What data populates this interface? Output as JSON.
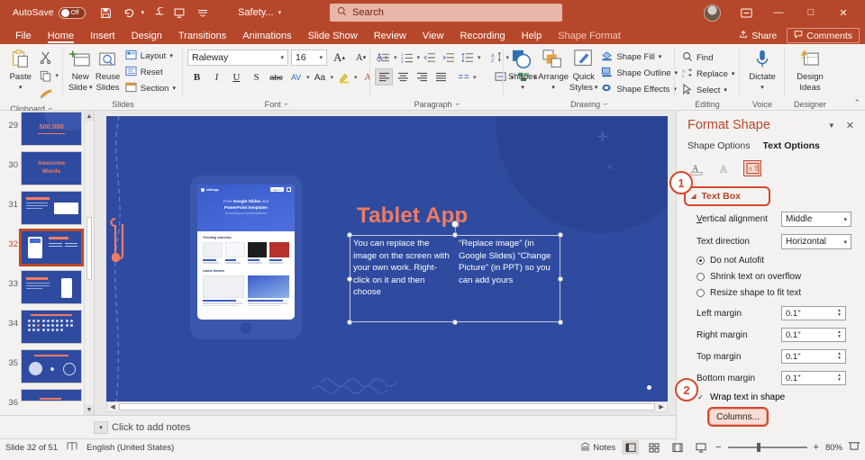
{
  "titlebar": {
    "autosave_label": "AutoSave",
    "autosave_state": "Off",
    "save_icon": "save-icon",
    "undo_icon": "undo-icon",
    "redo_icon": "redo-icon",
    "present_icon": "start-presentation-icon",
    "customize_icon": "customize-quick-access-icon",
    "filename": "Safety...",
    "search_placeholder": "Search",
    "search_icon": "search-icon",
    "account_icon": "user-avatar",
    "ribbon_display_icon": "ribbon-display-options-icon",
    "minimize": "—",
    "maximize": "□",
    "close": "✕"
  },
  "tabs": {
    "items": [
      {
        "label": "File",
        "active": false
      },
      {
        "label": "Home",
        "active": true
      },
      {
        "label": "Insert",
        "active": false
      },
      {
        "label": "Design",
        "active": false
      },
      {
        "label": "Transitions",
        "active": false
      },
      {
        "label": "Animations",
        "active": false
      },
      {
        "label": "Slide Show",
        "active": false
      },
      {
        "label": "Review",
        "active": false
      },
      {
        "label": "View",
        "active": false
      },
      {
        "label": "Recording",
        "active": false
      },
      {
        "label": "Help",
        "active": false
      },
      {
        "label": "Shape Format",
        "active": false
      }
    ],
    "share_label": "Share",
    "comments_label": "Comments"
  },
  "ribbon": {
    "clipboard": {
      "group_label": "Clipboard",
      "paste_label": "Paste",
      "cut_icon": "scissors-icon",
      "copy_icon": "copy-icon",
      "format_painter_icon": "format-painter-icon"
    },
    "slides": {
      "group_label": "Slides",
      "new_slide_label": "New\nSlide",
      "new_slide_line1": "New",
      "new_slide_line2": "Slide",
      "reuse_slides_line1": "Reuse",
      "reuse_slides_line2": "Slides",
      "layout_label": "Layout",
      "reset_label": "Reset",
      "section_label": "Section"
    },
    "font": {
      "group_label": "Font",
      "font_name": "Raleway",
      "font_size": "16",
      "grow_font": "A",
      "shrink_font": "A",
      "clear_formatting": "A",
      "bold": "B",
      "italic": "I",
      "underline": "U",
      "shadow": "S",
      "strikethrough": "abc",
      "char_spacing": "AV",
      "change_case": "Aa",
      "text_highlight": "highlight-icon",
      "font_color": "A"
    },
    "paragraph": {
      "group_label": "Paragraph",
      "bullets_icon": "bullets-icon",
      "numbering_icon": "numbering-icon",
      "decrease_indent_icon": "decrease-indent-icon",
      "increase_indent_icon": "increase-indent-icon",
      "line_spacing_icon": "line-spacing-icon",
      "align_left_icon": "align-left-icon",
      "align_center_icon": "align-center-icon",
      "align_right_icon": "align-right-icon",
      "justify_icon": "justify-icon",
      "columns_icon": "columns-icon",
      "text_direction_icon": "text-direction-icon",
      "align_text_icon": "align-text-icon",
      "smartart_icon": "convert-to-smartart-icon"
    },
    "drawing": {
      "group_label": "Drawing",
      "shapes_label": "Shapes",
      "arrange_label": "Arrange",
      "quick_styles_line1": "Quick",
      "quick_styles_line2": "Styles",
      "shape_fill_label": "Shape Fill",
      "shape_outline_label": "Shape Outline",
      "shape_effects_label": "Shape Effects"
    },
    "editing": {
      "group_label": "Editing",
      "find_label": "Find",
      "replace_label": "Replace",
      "select_label": "Select"
    },
    "voice": {
      "group_label": "Voice",
      "dictate_label": "Dictate"
    },
    "designer": {
      "group_label": "Designer",
      "design_ideas_line1": "Design",
      "design_ideas_line2": "Ideas"
    },
    "collapse_icon": "collapse-ribbon-icon"
  },
  "thumbnails": {
    "items": [
      {
        "number": "29",
        "kind": "big-number",
        "text": "500,000",
        "selected": false
      },
      {
        "number": "30",
        "kind": "two-line-title",
        "line1": "Awesome",
        "line2": "Words",
        "selected": false
      },
      {
        "number": "31",
        "kind": "text-left-image-right",
        "selected": false
      },
      {
        "number": "32",
        "kind": "image-left-text-right",
        "selected": true
      },
      {
        "number": "33",
        "kind": "text-left-phone-right",
        "selected": false
      },
      {
        "number": "34",
        "kind": "icon-grid",
        "selected": false
      },
      {
        "number": "35",
        "kind": "three-icons",
        "selected": false
      },
      {
        "number": "36",
        "kind": "partial",
        "selected": false
      }
    ]
  },
  "slide": {
    "title": "Tablet App",
    "text_column_1": "You can replace the image on the screen with your own work. Right-click on it and then choose",
    "text_column_2": "“Replace image” (in Google Slides) “Change Picture” (in PPT) so you can add yours",
    "tablet_hero_line1_a": "Free",
    "tablet_hero_line1_b": "Google Slides",
    "tablet_hero_line1_c": "and",
    "tablet_hero_line2": "PowerPoint templates",
    "tablet_hero_line3": "to boost your presentations",
    "tablet_section_1": "Trending searches",
    "tablet_section_2": "Latest themes",
    "tablet_logo": "slidesgo",
    "tablet_signin": "Sign in"
  },
  "notes": {
    "placeholder": "Click to add notes"
  },
  "status": {
    "slide_indicator": "Slide 32 of 51",
    "accessibility_icon": "accessibility-icon",
    "language": "English (United States)",
    "notes_label": "Notes",
    "normal_view_icon": "normal-view-icon",
    "slide_sorter_icon": "slide-sorter-icon",
    "reading_view_icon": "reading-view-icon",
    "slideshow_icon": "slideshow-icon",
    "zoom_out": "−",
    "zoom_in": "+",
    "zoom_level": "80%",
    "fit_slide_icon": "fit-slide-to-window-icon"
  },
  "pane": {
    "title": "Format Shape",
    "options_icon": "pane-options-icon",
    "close_icon": "close-icon",
    "tab_shape_options": "Shape Options",
    "tab_text_options": "Text Options",
    "icon_text_fill": "text-fill-outline-icon",
    "icon_text_effects": "text-effects-icon",
    "icon_textbox": "textbox-icon",
    "section_label": "Text Box",
    "vertical_alignment_label": "Vertical alignment",
    "vertical_alignment_value": "Middle",
    "text_direction_label": "Text direction",
    "text_direction_value": "Horizontal",
    "autofit_options": [
      {
        "label": "Do not Autofit",
        "selected": true
      },
      {
        "label": "Shrink text on overflow",
        "selected": false
      },
      {
        "label": "Resize shape to fit text",
        "selected": false
      }
    ],
    "left_margin_label": "Left margin",
    "left_margin_value": "0.1\"",
    "right_margin_label": "Right margin",
    "right_margin_value": "0.1\"",
    "top_margin_label": "Top margin",
    "top_margin_value": "0.1\"",
    "bottom_margin_label": "Bottom margin",
    "bottom_margin_value": "0.1\"",
    "wrap_text_label": "Wrap text in shape",
    "wrap_text_checked": true,
    "columns_label": "Columns...",
    "step_1": "1",
    "step_2": "2"
  },
  "colors": {
    "ribbon_red": "#b7472a",
    "slide_blue": "#2f4ba0",
    "accent_coral": "#ef7b63",
    "highlight_red": "#d6472a",
    "pane_bg": "#f3f2f1"
  }
}
